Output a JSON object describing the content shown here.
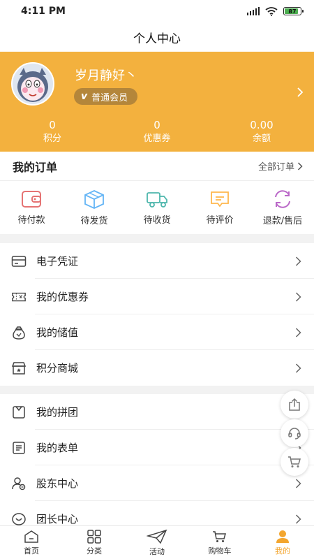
{
  "status_bar": {
    "time": "4:11 PM",
    "battery": "87",
    "battery_level": 0.87
  },
  "header": {
    "title": "个人中心"
  },
  "profile": {
    "username": "岁月静好丶",
    "member_level": "普通会员",
    "member_badge_letter": "v",
    "stats": [
      {
        "value": "0",
        "label": "积分"
      },
      {
        "value": "0",
        "label": "优惠券"
      },
      {
        "value": "0.00",
        "label": "余额"
      }
    ]
  },
  "orders": {
    "title": "我的订单",
    "all_label": "全部订单",
    "items": [
      {
        "label": "待付款",
        "icon": "wallet-icon",
        "color": "#e57373"
      },
      {
        "label": "待发货",
        "icon": "package-icon",
        "color": "#64b5f6"
      },
      {
        "label": "待收货",
        "icon": "truck-icon",
        "color": "#4db6ac"
      },
      {
        "label": "待评价",
        "icon": "comment-icon",
        "color": "#ffb74d"
      },
      {
        "label": "退款/售后",
        "icon": "refund-icon",
        "color": "#ba68c8"
      }
    ]
  },
  "menu_group_1": [
    {
      "label": "电子凭证",
      "icon": "card-icon"
    },
    {
      "label": "我的优惠券",
      "icon": "coupon-icon"
    },
    {
      "label": "我的储值",
      "icon": "money-bag-icon"
    },
    {
      "label": "积分商城",
      "icon": "store-icon"
    }
  ],
  "menu_group_2": [
    {
      "label": "我的拼团",
      "icon": "group-buy-icon"
    },
    {
      "label": "我的表单",
      "icon": "form-icon"
    },
    {
      "label": "股东中心",
      "icon": "shareholder-icon"
    },
    {
      "label": "团长中心",
      "icon": "leader-icon"
    }
  ],
  "floating_buttons": [
    "share-icon",
    "customer-service-icon",
    "cart-icon"
  ],
  "tabbar": [
    {
      "label": "首页",
      "icon": "home-icon",
      "active": false
    },
    {
      "label": "分类",
      "icon": "category-icon",
      "active": false
    },
    {
      "label": "活动",
      "icon": "paper-plane-icon",
      "active": false
    },
    {
      "label": "购物车",
      "icon": "cart-icon",
      "active": false
    },
    {
      "label": "我的",
      "icon": "person-icon",
      "active": true
    }
  ],
  "colors": {
    "brand": "#f3b13e",
    "badge": "#b4863a",
    "active_tab": "#f3a62f"
  }
}
